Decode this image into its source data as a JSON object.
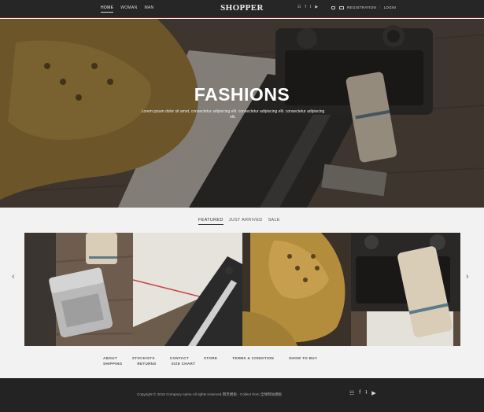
{
  "header": {
    "nav": [
      {
        "label": "HOME",
        "active": true
      },
      {
        "label": "WOMAN",
        "active": false
      },
      {
        "label": "MAN",
        "active": false
      }
    ],
    "brand": "SHOPPER",
    "social_icons": [
      "rss-icon",
      "facebook-icon",
      "twitter-icon",
      "youtube-icon"
    ],
    "social_glyphs": [
      "☷",
      "f",
      "ʇ",
      "▶"
    ],
    "registration_label": "REGISTRATION",
    "divider": "/",
    "login_label": "LOGIN",
    "accent_color": "#7a1f24"
  },
  "hero": {
    "title": "FASHIONS",
    "subtitle": "Lorem ipsum dolor sit amet, consectetur adipiscing elit. consectetur adipiscing elit. consectetur adipiscing elit."
  },
  "tabs": [
    {
      "label": "FEATURED",
      "active": true
    },
    {
      "label": "JUST ARRIVED",
      "active": false
    },
    {
      "label": "SALE",
      "active": false
    }
  ],
  "carousel": {
    "prev_glyph": "‹",
    "next_glyph": "›",
    "items": [
      "lighter-product",
      "notebook-pen-product",
      "leather-boots-product",
      "camera-product"
    ]
  },
  "footer_links": [
    "ABOUT",
    "STOCKISTS",
    "CONTACT",
    "STORE",
    "TERMS & CONDITION",
    "SHOW TO BUY",
    "SHIPPING",
    "RETURNS",
    "SIZE CHART"
  ],
  "footer": {
    "copyright": "Copyright © 2015 Company name All rights reserved.网页模板 - Collect from 全球网站模板",
    "social_icons": [
      "rss-icon",
      "facebook-icon",
      "twitter-icon",
      "youtube-icon"
    ],
    "social_glyphs": [
      "☷",
      "f",
      "ʇ",
      "▶"
    ]
  }
}
